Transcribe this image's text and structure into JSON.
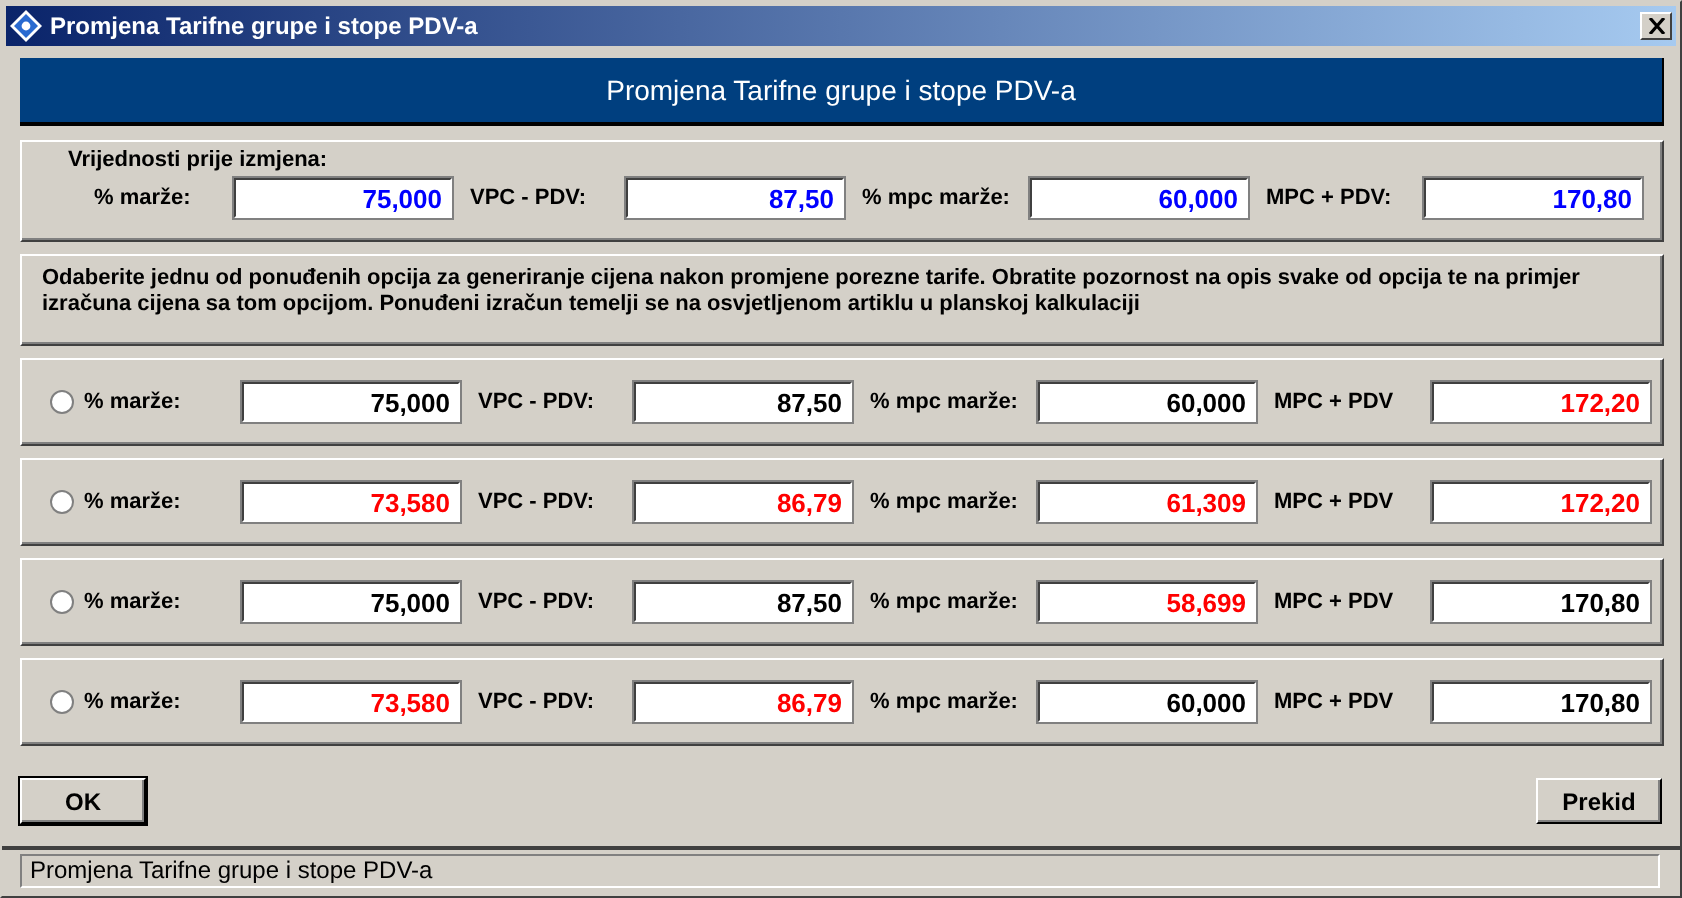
{
  "window": {
    "title": "Promjena Tarifne grupe i stope PDV-a"
  },
  "header": "Promjena Tarifne grupe i stope PDV-a",
  "before": {
    "title": "Vrijednosti prije izmjena:",
    "fields": [
      {
        "label": "% marže:",
        "value": "75,000",
        "color": "#0000ff"
      },
      {
        "label": "VPC - PDV:",
        "value": "87,50",
        "color": "#0000ff"
      },
      {
        "label": "% mpc marže:",
        "value": "60,000",
        "color": "#0000ff"
      },
      {
        "label": "MPC + PDV:",
        "value": "170,80",
        "color": "#0000ff"
      }
    ]
  },
  "description": "Odaberite jednu od ponuđenih opcija za generiranje cijena nakon promjene porezne tarife. Obratite pozornost na opis svake od opcija te na primjer izračuna cijena sa tom opcijom. Ponuđeni izračun temelji se na osvjetljenom artiklu u planskoj kalkulaciji",
  "options": [
    {
      "selected": false,
      "fields": [
        {
          "label": "% marže:",
          "value": "75,000",
          "color": "#000000"
        },
        {
          "label": "VPC - PDV:",
          "value": "87,50",
          "color": "#000000"
        },
        {
          "label": "% mpc marže:",
          "value": "60,000",
          "color": "#000000"
        },
        {
          "label": "MPC + PDV",
          "value": "172,20",
          "color": "#ff0000"
        }
      ]
    },
    {
      "selected": false,
      "fields": [
        {
          "label": "% marže:",
          "value": "73,580",
          "color": "#ff0000"
        },
        {
          "label": "VPC - PDV:",
          "value": "86,79",
          "color": "#ff0000"
        },
        {
          "label": "% mpc marže:",
          "value": "61,309",
          "color": "#ff0000"
        },
        {
          "label": "MPC + PDV",
          "value": "172,20",
          "color": "#ff0000"
        }
      ]
    },
    {
      "selected": false,
      "fields": [
        {
          "label": "% marže:",
          "value": "75,000",
          "color": "#000000"
        },
        {
          "label": "VPC - PDV:",
          "value": "87,50",
          "color": "#000000"
        },
        {
          "label": "% mpc marže:",
          "value": "58,699",
          "color": "#ff0000"
        },
        {
          "label": "MPC + PDV",
          "value": "170,80",
          "color": "#000000"
        }
      ]
    },
    {
      "selected": false,
      "fields": [
        {
          "label": "% marže:",
          "value": "73,580",
          "color": "#ff0000"
        },
        {
          "label": "VPC - PDV:",
          "value": "86,79",
          "color": "#ff0000"
        },
        {
          "label": "% mpc marže:",
          "value": "60,000",
          "color": "#000000"
        },
        {
          "label": "MPC + PDV",
          "value": "170,80",
          "color": "#000000"
        }
      ]
    }
  ],
  "buttons": [
    {
      "label": "OK"
    },
    {
      "label": "Prekid"
    }
  ],
  "status_bar": "Promjena Tarifne grupe i stope PDV-a"
}
